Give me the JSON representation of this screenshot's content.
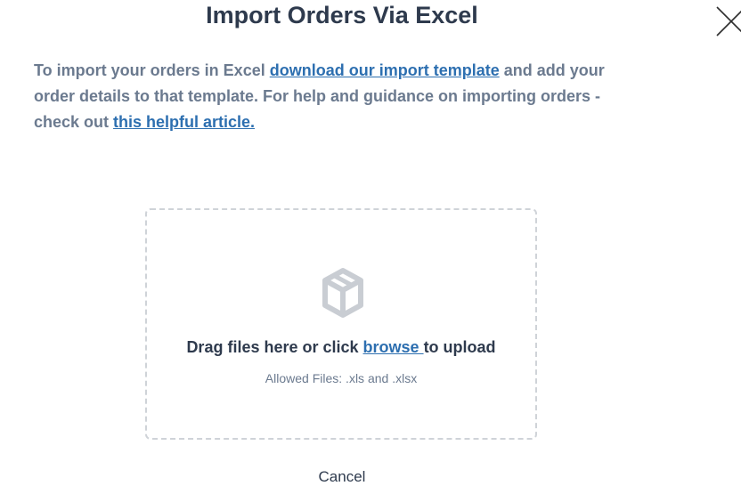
{
  "modal": {
    "title": "Import Orders Via Excel",
    "close_icon": "close-icon"
  },
  "intro": {
    "text_before_link1": "To import your orders in Excel ",
    "link1_label": "download our import template",
    "text_between_links": " and add your order details to that template. For help and guidance on importing orders - check out ",
    "link2_label": "this helpful article."
  },
  "dropzone": {
    "icon": "upload-box-icon",
    "text_before_link": "Drag files here or click ",
    "link_label": "browse ",
    "text_after_link": "to upload",
    "allowed_files": "Allowed Files: .xls and .xlsx"
  },
  "footer": {
    "cancel_label": "Cancel"
  },
  "colors": {
    "title": "#2e3a4d",
    "body_text": "#6b7a8f",
    "link": "#2d6fb0",
    "icon": "#c9cdd3",
    "dashed_border": "#cfd3d8"
  }
}
